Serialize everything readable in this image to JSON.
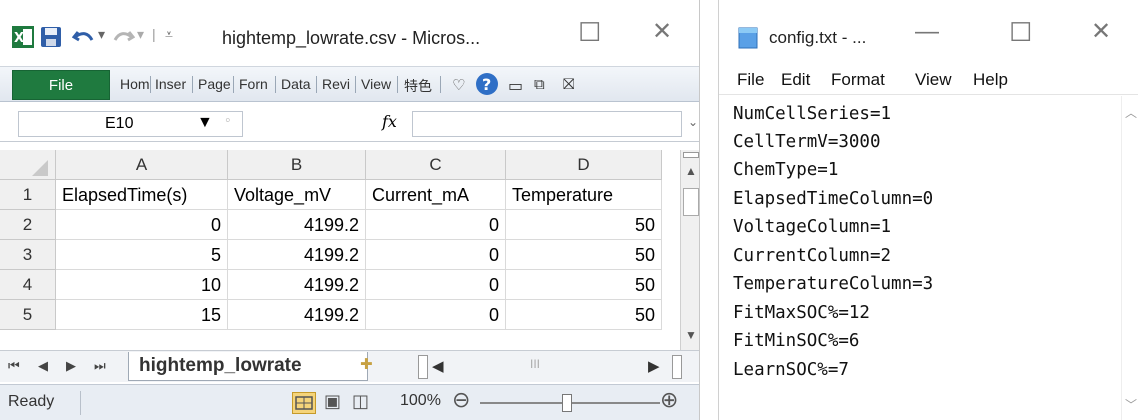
{
  "excel": {
    "title": "hightemp_lowrate.csv  -  Micros...",
    "file_tab": "File",
    "ribbon_tabs": [
      "Hom",
      "Inser",
      "Page",
      "Forn",
      "Data",
      "Revi",
      "View",
      "特色"
    ],
    "name_box": "E10",
    "fx": "fx",
    "columns": [
      "A",
      "B",
      "C",
      "D"
    ],
    "rows": [
      {
        "num": "1",
        "cells": [
          "ElapsedTime(s)",
          "Voltage_mV",
          "Current_mA",
          "Temperature"
        ]
      },
      {
        "num": "2",
        "cells": [
          "0",
          "4199.2",
          "0",
          "50"
        ]
      },
      {
        "num": "3",
        "cells": [
          "5",
          "4199.2",
          "0",
          "50"
        ]
      },
      {
        "num": "4",
        "cells": [
          "10",
          "4199.2",
          "0",
          "50"
        ]
      },
      {
        "num": "5",
        "cells": [
          "15",
          "4199.2",
          "0",
          "50"
        ]
      }
    ],
    "sheet_tab": "hightemp_lowrate",
    "status": "Ready",
    "zoom": "100%",
    "accent": "#1f7a3f"
  },
  "notepad": {
    "title": "config.txt - ...",
    "menu": [
      "File",
      "Edit",
      "Format",
      "View",
      "Help"
    ],
    "lines": [
      "NumCellSeries=1",
      "CellTermV=3000",
      "ChemType=1",
      "ElapsedTimeColumn=0",
      "VoltageColumn=1",
      "CurrentColumn=2",
      "TemperatureColumn=3",
      "FitMaxSOC%=12",
      "FitMinSOC%=6",
      "LearnSOC%=7"
    ]
  }
}
